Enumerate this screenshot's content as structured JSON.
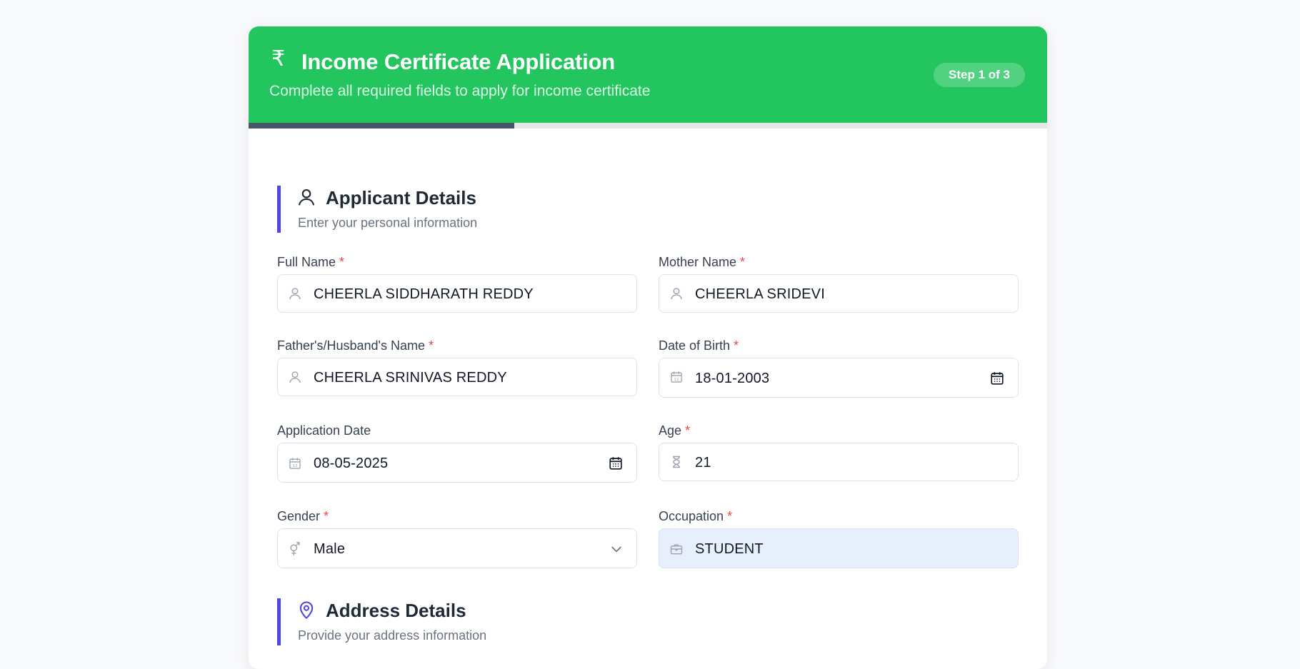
{
  "header": {
    "currency_symbol": "₹",
    "title": "Income Certificate Application",
    "subtitle": "Complete all required fields to apply for income certificate",
    "step_badge": "Step 1 of 3",
    "color": "#22c55e"
  },
  "progress": {
    "current_step": 1,
    "total_steps": 3,
    "fraction": 0.333
  },
  "sections": {
    "applicant": {
      "title": "Applicant Details",
      "subtitle": "Enter your personal information",
      "icon": "user-icon"
    },
    "address": {
      "title": "Address Details",
      "subtitle": "Provide your address information",
      "icon": "map-pin-icon"
    }
  },
  "fields": {
    "full_name": {
      "label": "Full Name",
      "required_mark": "*",
      "value": "CHEERLA SIDDHARATH REDDY",
      "icon": "user-icon"
    },
    "mother_name": {
      "label": "Mother Name",
      "required_mark": "*",
      "value": "CHEERLA SRIDEVI",
      "icon": "user-icon"
    },
    "father_name": {
      "label": "Father's/Husband's Name",
      "required_mark": "*",
      "value": "CHEERLA SRINIVAS REDDY",
      "icon": "user-icon"
    },
    "dob": {
      "label": "Date of Birth",
      "required_mark": "*",
      "value": "18-01-2003",
      "icon": "calendar-icon"
    },
    "application_date": {
      "label": "Application Date",
      "value": "08-05-2025",
      "icon": "calendar-icon"
    },
    "age": {
      "label": "Age",
      "required_mark": "*",
      "value": "21",
      "icon": "hourglass-icon"
    },
    "gender": {
      "label": "Gender",
      "required_mark": "*",
      "value": "Male",
      "icon": "gender-icon"
    },
    "occupation": {
      "label": "Occupation",
      "required_mark": "*",
      "value": "STUDENT",
      "icon": "briefcase-icon"
    }
  },
  "colors": {
    "accent": "#4f46e5",
    "required": "#ef4444",
    "progress_fill": "#475569",
    "autofill_bg": "#e8effc"
  }
}
